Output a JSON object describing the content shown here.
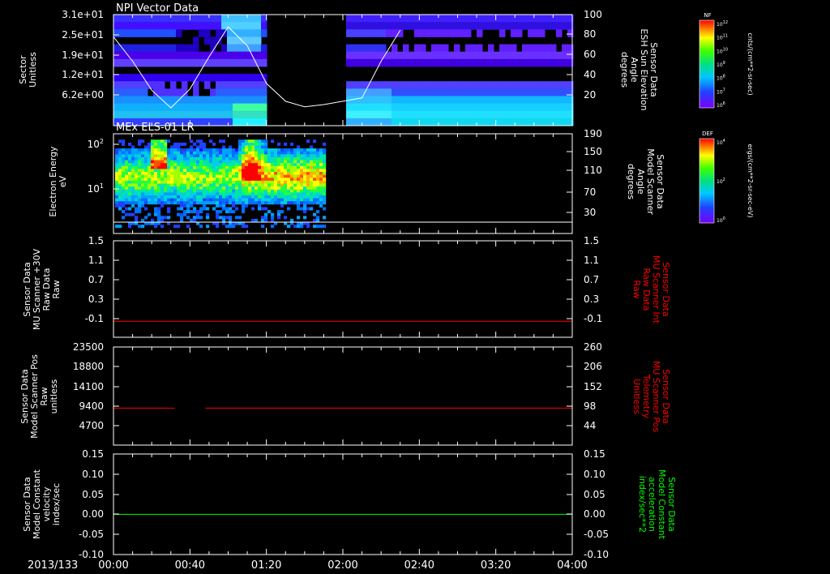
{
  "date_label": "2013/133",
  "time_ticks": [
    "00:00",
    "00:40",
    "01:20",
    "02:00",
    "02:40",
    "03:20",
    "04:00"
  ],
  "panels": [
    {
      "title": "NPI Vector Data",
      "left_ylabel": [
        "Sector",
        "Unitless"
      ],
      "left_ticks": [
        "3.1e+01",
        "2.5e+01",
        "1.9e+01",
        "1.2e+01",
        "6.2e+00"
      ],
      "right_ticks": [
        "100",
        "80",
        "60",
        "40",
        "20"
      ],
      "right_ylabel": [
        "Sensor Data",
        "ESH Sun Elevation",
        "Angle",
        "degrees"
      ],
      "right_color": "#ffffff"
    },
    {
      "title": "MEx ELS-01 LR",
      "left_ylabel": [
        "Electron Energy",
        "eV"
      ],
      "left_ticks": [
        "10",
        "10"
      ],
      "left_tick_exps": [
        "2",
        "1"
      ],
      "right_ticks": [
        "190",
        "150",
        "110",
        "70",
        "30"
      ],
      "right_ylabel": [
        "Sensor Data",
        "Model Scanner",
        "Angle",
        "degrees"
      ],
      "right_color": "#ffffff"
    },
    {
      "left_ylabel": [
        "Sensor Data",
        "MU Scanner +30V",
        "Raw Data",
        "Raw"
      ],
      "left_ticks": [
        "1.5",
        "1.1",
        "0.7",
        "0.3",
        "-0.1"
      ],
      "right_ticks": [
        "1.5",
        "1.1",
        "0.7",
        "0.3",
        "-0.1"
      ],
      "right_ylabel": [
        "Sensor Data",
        "MU Scanner Int",
        "Raw Data",
        "Raw"
      ],
      "right_color": "#ff0000"
    },
    {
      "left_ylabel": [
        "Sensor Data",
        "Model Scanner Pos",
        "Raw",
        "unitless"
      ],
      "left_ticks": [
        "23500",
        "18800",
        "14100",
        "9400",
        "4700"
      ],
      "right_ticks": [
        "260",
        "206",
        "152",
        "98",
        "44"
      ],
      "right_ylabel": [
        "Sensor Data",
        "MU Scanner Pos",
        "Telemetry",
        "Unitless"
      ],
      "right_color": "#ff0000"
    },
    {
      "left_ylabel": [
        "Sensor Data",
        "Model Constant",
        "velocity",
        "index/sec"
      ],
      "left_ticks": [
        "0.15",
        "0.10",
        "0.05",
        "0.00",
        "-0.05",
        "-0.10"
      ],
      "right_ticks": [
        "0.15",
        "0.10",
        "0.05",
        "0.00",
        "-0.05",
        "-0.10"
      ],
      "right_ylabel": [
        "Sensor Data",
        "Model Constant",
        "acceleration",
        "index/sec**2"
      ],
      "right_color": "#00ff00"
    }
  ],
  "colorbars": [
    {
      "label": "NF",
      "units": "cnts/(cm**2-sr-sec)",
      "ticks": [
        "10",
        "10",
        "10",
        "10",
        "10",
        "10",
        "10"
      ],
      "tick_exps": [
        "12",
        "11",
        "10",
        "9",
        "8",
        "7",
        "6"
      ]
    },
    {
      "label": "DEF",
      "units": "ergs/(cm**2-sr-sec-eV)",
      "ticks": [
        "10",
        "10",
        "10"
      ],
      "tick_exps": [
        "4",
        "2",
        "0"
      ]
    }
  ],
  "colors": {
    "red_line": "#ff0000",
    "green_line": "#00ff00",
    "axis": "#ffffff"
  },
  "chart_data": [
    {
      "type": "heatmap",
      "title": "NPI Vector Data",
      "x_range": [
        "00:00",
        "04:00"
      ],
      "ylabel": "Sector Unitless",
      "y2label": "Sensor Data ESH Sun Elevation Angle degrees",
      "y2lim": [
        0,
        100
      ],
      "data_gap": [
        "01:20",
        "02:00"
      ],
      "overlay_line": {
        "name": "ESH Sun Elevation Angle",
        "x": [
          "00:00",
          "00:10",
          "00:20",
          "00:30",
          "00:40",
          "00:50",
          "01:00",
          "01:10",
          "01:20",
          "01:30",
          "01:40",
          "01:50",
          "02:00",
          "02:10",
          "02:20",
          "02:30"
        ],
        "y": [
          80,
          58,
          32,
          16,
          33,
          62,
          89,
          72,
          38,
          22,
          17,
          19,
          22,
          25,
          58,
          86
        ]
      }
    },
    {
      "type": "heatmap",
      "title": "MEx ELS-01 LR",
      "x_range": [
        "00:00",
        "04:00"
      ],
      "ylabel": "Electron Energy eV",
      "y_scale": "log",
      "y2label": "Sensor Data Model Scanner Angle degrees",
      "y2lim": [
        10,
        190
      ],
      "data_end": "01:51"
    },
    {
      "type": "line",
      "x": [
        "00:00",
        "04:00"
      ],
      "series": [
        {
          "y": [
            0.0,
            0.0
          ]
        }
      ],
      "ylim": [
        -0.3,
        1.5
      ],
      "y2lim": [
        -0.3,
        1.5
      ]
    },
    {
      "type": "line",
      "x": [
        "00:00",
        "00:32",
        "00:32",
        "00:48",
        "00:48",
        "04:00"
      ],
      "series": [
        {
          "y": [
            98,
            98,
            null,
            null,
            98,
            98
          ]
        }
      ],
      "ylim": [
        0,
        23500
      ],
      "y2lim": [
        0,
        260
      ]
    },
    {
      "type": "line",
      "x": [
        "00:00",
        "04:00"
      ],
      "series": [
        {
          "y": [
            0.0,
            0.0
          ]
        }
      ],
      "ylim": [
        -0.1,
        0.15
      ],
      "y2lim": [
        -0.1,
        0.15
      ]
    }
  ]
}
